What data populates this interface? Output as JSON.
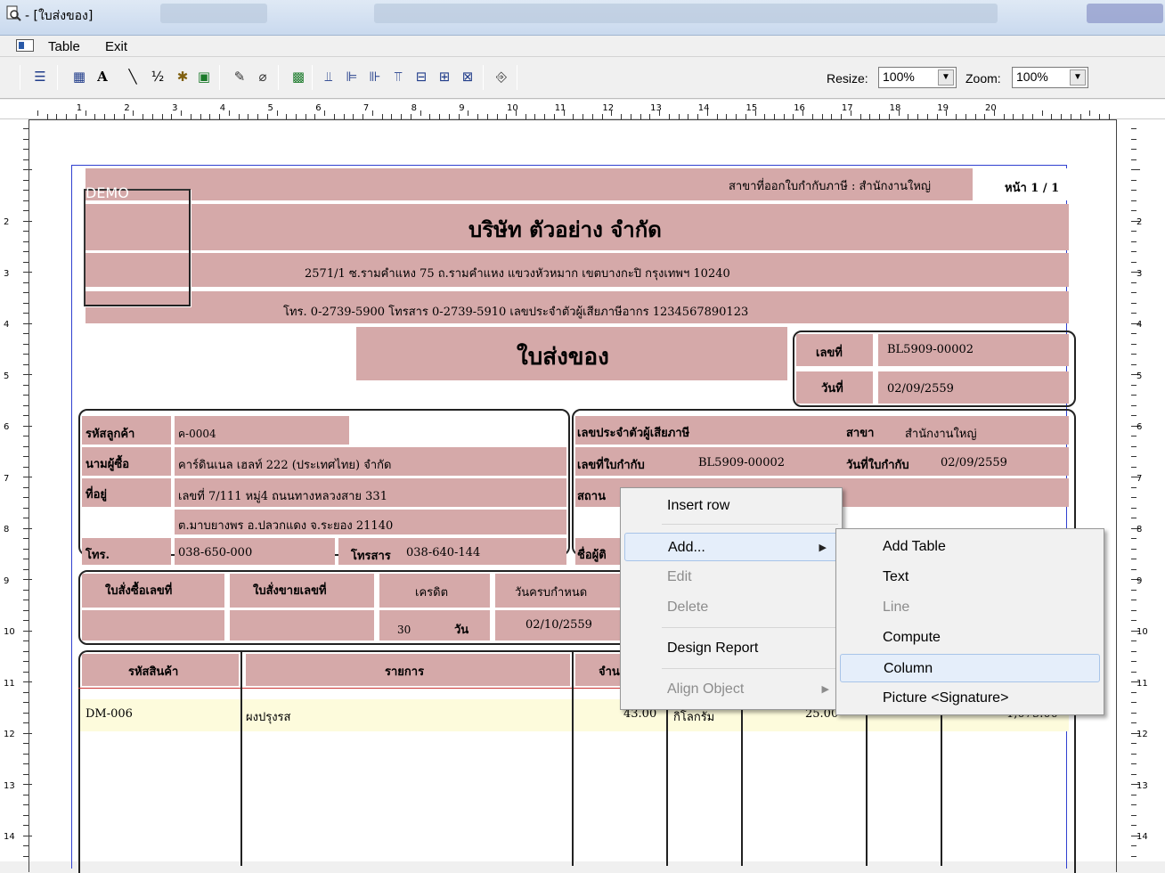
{
  "window": {
    "title": "- [ใบส่งของ]"
  },
  "menubar": {
    "items": [
      "Table",
      "Exit"
    ]
  },
  "toolbar": {
    "resize_label": "Resize:",
    "resize_value": "100%",
    "zoom_label": "Zoom:",
    "zoom_value": "100%"
  },
  "ruler": {
    "top": [
      "1",
      "2",
      "3",
      "4",
      "5",
      "6",
      "7",
      "8",
      "9",
      "10",
      "11",
      "12",
      "13",
      "14",
      "15",
      "16",
      "17",
      "18",
      "19",
      "20"
    ],
    "left": [
      "2",
      "3",
      "4",
      "5",
      "6",
      "7",
      "8",
      "9",
      "10",
      "11",
      "12",
      "13",
      "14"
    ]
  },
  "report": {
    "demo": "DEMO",
    "branch_label": "สาขาที่ออกใบกำกับภาษี : สำนักงานใหญ่",
    "page": "หน้า 1 / 1",
    "company": "บริษัท ตัวอย่าง จำกัด",
    "address": "2571/1 ซ.รามคำแหง 75 ถ.รามคำแหง แขวงหัวหมาก เขตบางกะปิ กรุงเทพฯ 10240",
    "contact": "โทร. 0-2739-5900  โทรสาร 0-2739-5910  เลขประจำตัวผู้เสียภาษีอากร 1234567890123",
    "doc_title": "ใบส่งของ",
    "doc_no_label": "เลขที่",
    "doc_no": "BL5909-00002",
    "doc_date_label": "วันที่",
    "doc_date": "02/09/2559",
    "cust_code_label": "รหัสลูกค้า",
    "cust_code": "ค-0004",
    "buyer_label": "นามผู้ซื้อ",
    "buyer": "คาร์ดินเนล เฮลท์ 222 (ประเทศไทย) จำกัด",
    "addr_label": "ที่อยู่",
    "addr1": "เลขที่ 7/111 หมู่4 ถนนทางหลวงสาย 331",
    "addr2": "ต.มาบยางพร อ.ปลวกแดง จ.ระยอง 21140",
    "tel_label": "โทร.",
    "tel": "038-650-000",
    "fax_label": "โทรสาร",
    "fax": "038-640-144",
    "taxid_label": "เลขประจำตัวผู้เสียภาษี",
    "branch2_label": "สาขา",
    "branch2": "สำนักงานใหญ่",
    "invoice_no_label": "เลขที่ใบกำกับ",
    "invoice_no": "BL5909-00002",
    "invoice_date_label": "วันที่ใบกำกับ",
    "invoice_date": "02/09/2559",
    "place_label": "สถาน",
    "contact_label": "ชื่อผู้ติ",
    "po_label": "ใบสั่งซื้อเลขที่",
    "so_label": "ใบสั่งขายเลขที่",
    "credit_label": "เครดิต",
    "due_label": "วันครบกำหนด",
    "credit_days": "30",
    "credit_unit": "วัน",
    "due_date": "02/10/2559",
    "col_code": "รหัสสินค้า",
    "col_desc": "รายการ",
    "col_qty": "จำน",
    "row": {
      "code": "DM-006",
      "desc": "ผงปรุงรส",
      "qty": "43.00",
      "unit": "กิโลกรัม",
      "price": "25.00",
      "amount": "1,075.00"
    }
  },
  "context_menu": {
    "items": [
      {
        "label": "Insert row",
        "enabled": true
      },
      {
        "label": "Add...",
        "enabled": true,
        "submenu": true
      },
      {
        "label": "Edit",
        "enabled": false
      },
      {
        "label": "Delete",
        "enabled": false
      },
      {
        "label": "Design Report",
        "enabled": true
      },
      {
        "label": "Align Object",
        "enabled": false,
        "submenu": true
      }
    ]
  },
  "submenu": {
    "items": [
      {
        "label": "Add Table",
        "enabled": true
      },
      {
        "label": "Text",
        "enabled": true
      },
      {
        "label": "Line",
        "enabled": false
      },
      {
        "label": "Compute",
        "enabled": true
      },
      {
        "label": "Column",
        "enabled": true,
        "highlighted": true
      },
      {
        "label": "Picture <Signature>",
        "enabled": true
      }
    ]
  }
}
